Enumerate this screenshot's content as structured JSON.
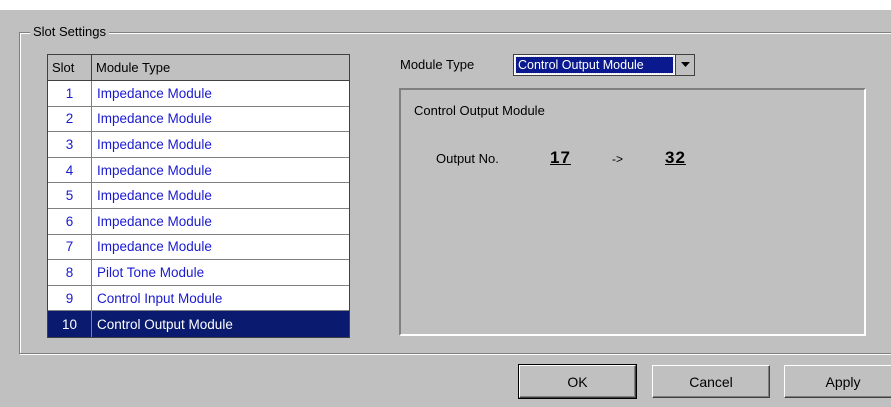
{
  "group": {
    "title": "Slot Settings"
  },
  "table": {
    "headers": {
      "slot": "Slot",
      "type": "Module Type"
    },
    "rows": [
      {
        "slot": "1",
        "type": "Impedance Module"
      },
      {
        "slot": "2",
        "type": "Impedance Module"
      },
      {
        "slot": "3",
        "type": "Impedance Module"
      },
      {
        "slot": "4",
        "type": "Impedance Module"
      },
      {
        "slot": "5",
        "type": "Impedance Module"
      },
      {
        "slot": "6",
        "type": "Impedance Module"
      },
      {
        "slot": "7",
        "type": "Impedance Module"
      },
      {
        "slot": "8",
        "type": "Pilot Tone Module"
      },
      {
        "slot": "9",
        "type": "Control Input Module"
      },
      {
        "slot": "10",
        "type": "Control Output Module"
      }
    ],
    "selected_slot": "10"
  },
  "module_type": {
    "label": "Module Type",
    "value": "Control Output Module",
    "icon": "dropdown-arrow-icon"
  },
  "panel": {
    "title": "Control Output Module",
    "output_label": "Output No.",
    "from": "17",
    "arrow": "->",
    "to": "32"
  },
  "buttons": {
    "ok": "OK",
    "cancel": "Cancel",
    "apply": "Apply"
  },
  "colors": {
    "selection": "#0a1a6e",
    "list_text": "#1a1ad0",
    "face": "#c0c0c0"
  }
}
